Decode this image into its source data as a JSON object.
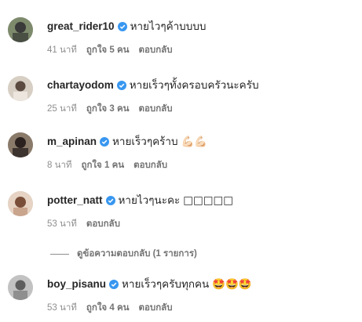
{
  "comments": [
    {
      "username": "great_rider10",
      "text": "หายไวๆค้าบบบบ",
      "emoji": "",
      "time": "41 นาที",
      "likes": "ถูกใจ 5 คน",
      "reply": "ตอบกลับ",
      "avatar_color": "#6b7a5e"
    },
    {
      "username": "chartayodom",
      "text": "หายเร็วๆทั้งครอบครัวนะครับ",
      "emoji": "",
      "time": "25 นาที",
      "likes": "ถูกใจ 3 คน",
      "reply": "ตอบกลับ",
      "avatar_color": "#c8b9a8"
    },
    {
      "username": "m_apinan",
      "text": "หายเร็วๆคร้าบ",
      "emoji": "💪🏻💪🏻",
      "time": "8 นาที",
      "likes": "ถูกใจ 1 คน",
      "reply": "ตอบกลับ",
      "avatar_color": "#3d3430"
    },
    {
      "username": "potter_natt",
      "text": "หายไวๆนะคะ",
      "emoji": "□□□□□",
      "time": "53 นาที",
      "likes": "",
      "reply": "ตอบกลับ",
      "avatar_color": "#b98a72"
    },
    {
      "username": "boy_pisanu",
      "text": "หายเร็วๆครับทุกคน",
      "emoji": "🤩🤩🤩",
      "time": "53 นาที",
      "likes": "ถูกใจ 4 คน",
      "reply": "ตอบกลับ",
      "avatar_color": "#9b9b9b"
    }
  ],
  "view_replies": "ดูข้อความตอบกลับ (1 รายการ)",
  "colors": {
    "verified": "#3897f0",
    "meta_text": "#8e8e8e"
  }
}
